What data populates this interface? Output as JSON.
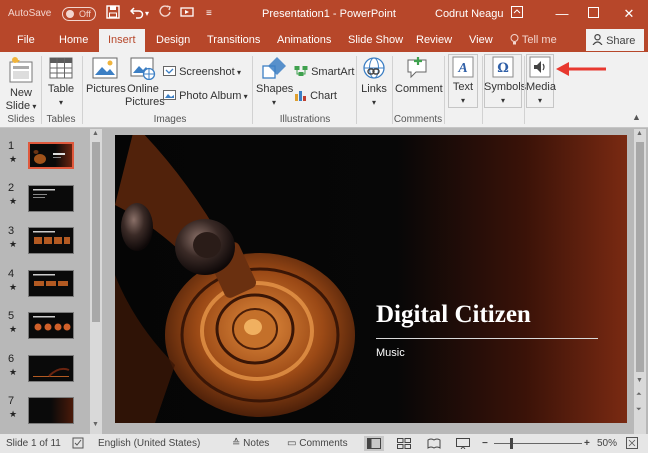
{
  "titlebar": {
    "autosave_label": "AutoSave",
    "autosave_state": "Off",
    "title": "Presentation1 - PowerPoint",
    "user": "Codrut Neagu",
    "accent": "#b7472a"
  },
  "tabs": {
    "items": [
      "File",
      "Home",
      "Insert",
      "Design",
      "Transitions",
      "Animations",
      "Slide Show",
      "Review",
      "View"
    ],
    "active": "Insert",
    "tell_me": "Tell me",
    "share": "Share"
  },
  "ribbon": {
    "new_slide": [
      "New",
      "Slide"
    ],
    "table": "Table",
    "pictures": "Pictures",
    "online_pictures": [
      "Online",
      "Pictures"
    ],
    "screenshot": "Screenshot",
    "photo_album": "Photo Album",
    "shapes": "Shapes",
    "smartart": "SmartArt",
    "chart": "Chart",
    "links": "Links",
    "comment": "Comment",
    "text": "Text",
    "symbols": "Symbols",
    "media": "Media",
    "groups": {
      "slides": "Slides",
      "tables": "Tables",
      "images": "Images",
      "illustrations": "Illustrations",
      "comments": "Comments"
    }
  },
  "slides_panel": {
    "numbers": [
      "1",
      "2",
      "3",
      "4",
      "5",
      "6",
      "7"
    ],
    "selected": 1
  },
  "slide": {
    "title": "Digital Citizen",
    "subtitle": "Music"
  },
  "statusbar": {
    "slide_info": "Slide 1 of 11",
    "language": "English (United States)",
    "notes": "Notes",
    "comments": "Comments",
    "zoom": "50%"
  }
}
